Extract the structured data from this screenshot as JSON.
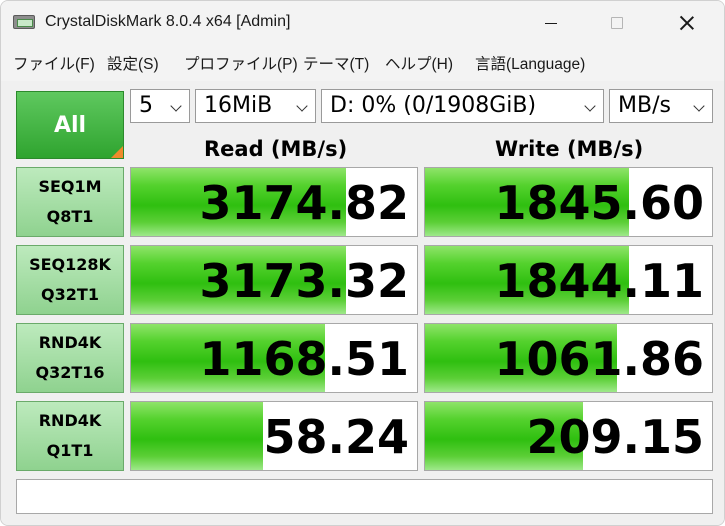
{
  "window": {
    "title": "CrystalDiskMark 8.0.4 x64 [Admin]"
  },
  "menu": [
    "ファイル(F)",
    "設定(S)",
    "プロファイル(P)",
    "テーマ(T)",
    "ヘルプ(H)",
    "言語(Language)"
  ],
  "controls": {
    "all_label": "All",
    "count": "5",
    "size": "16MiB",
    "drive": "D: 0% (0/1908GiB)",
    "unit": "MB/s"
  },
  "headers": {
    "read": "Read (MB/s)",
    "write": "Write (MB/s)"
  },
  "tests": [
    {
      "line1": "SEQ1M",
      "line2": "Q8T1",
      "read": "3174.82",
      "write": "1845.60",
      "read_fill": 0.75,
      "write_fill": 0.71
    },
    {
      "line1": "SEQ128K",
      "line2": "Q32T1",
      "read": "3173.32",
      "write": "1844.11",
      "read_fill": 0.75,
      "write_fill": 0.71
    },
    {
      "line1": "RND4K",
      "line2": "Q32T16",
      "read": "1168.51",
      "write": "1061.86",
      "read_fill": 0.68,
      "write_fill": 0.67
    },
    {
      "line1": "RND4K",
      "line2": "Q1T1",
      "read": "58.24",
      "write": "209.15",
      "read_fill": 0.46,
      "write_fill": 0.55
    }
  ],
  "colors": {
    "accent_green": "#2fbf10",
    "all_button": "#3db33d",
    "corner_orange": "#f08a2c"
  },
  "comment": ""
}
